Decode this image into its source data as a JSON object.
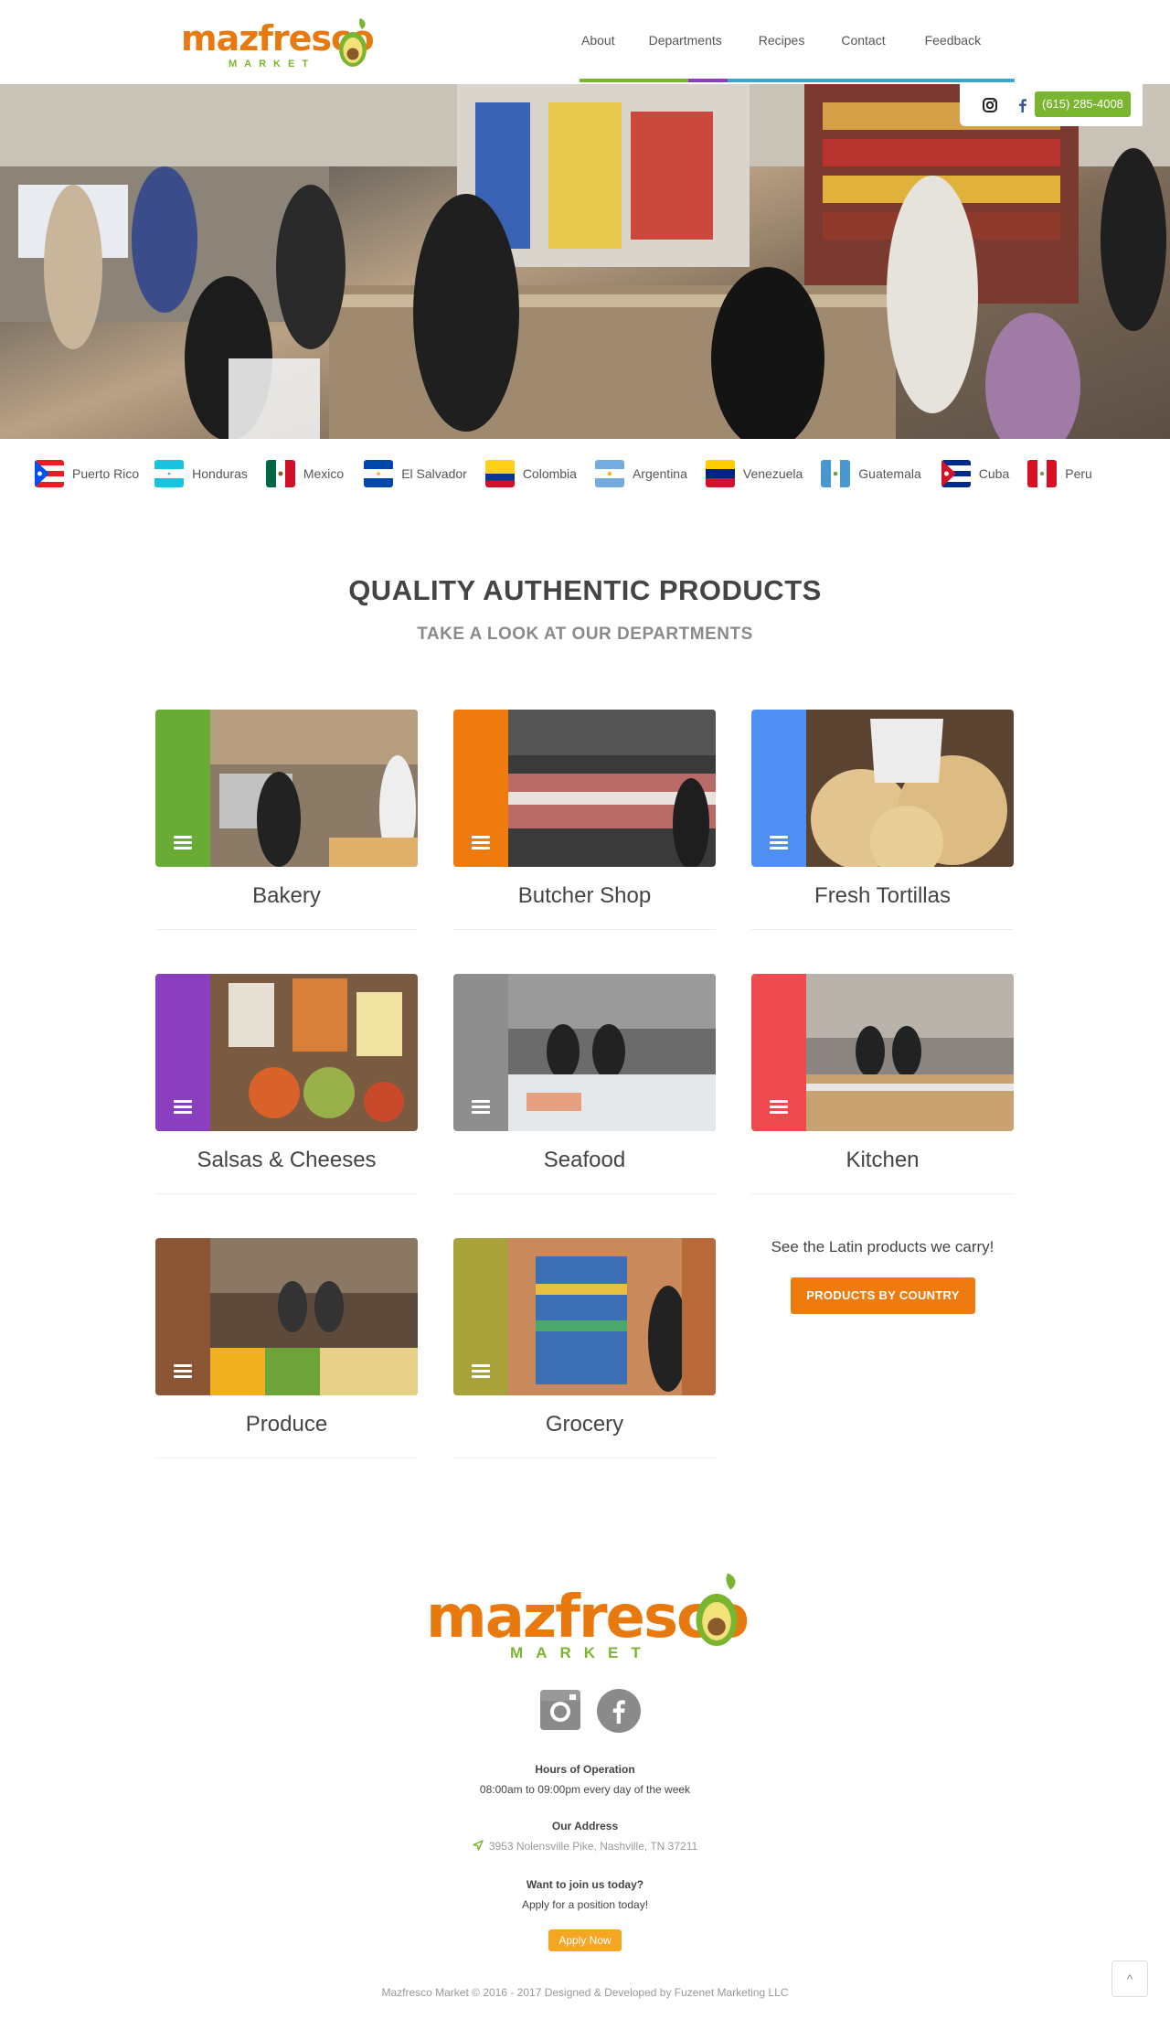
{
  "brand": {
    "logo_word": "mazfresco",
    "logo_sub": "MARKET",
    "colors": {
      "orange": "#e8790f",
      "green": "#7ab530"
    }
  },
  "nav": {
    "items": [
      "About",
      "Departments",
      "Recipes",
      "Contact",
      "Feedback"
    ]
  },
  "header_social": {
    "icons": [
      "instagram-icon",
      "facebook-icon"
    ],
    "phone": "(615) 285-4008"
  },
  "countries": [
    "Puerto Rico",
    "Honduras",
    "Mexico",
    "El Salvador",
    "Colombia",
    "Argentina",
    "Venezuela",
    "Guatemala",
    "Cuba",
    "Peru"
  ],
  "departments_section": {
    "title": "QUALITY AUTHENTIC PRODUCTS",
    "subtitle": "TAKE A LOOK AT OUR DEPARTMENTS"
  },
  "departments": [
    {
      "name": "Bakery",
      "color": "#6aab35"
    },
    {
      "name": "Butcher Shop",
      "color": "#ef7b0f"
    },
    {
      "name": "Fresh Tortillas",
      "color": "#4f8ef2"
    },
    {
      "name": "Salsas & Cheeses",
      "color": "#8a3fbf"
    },
    {
      "name": "Seafood",
      "color": "#8e8e8e"
    },
    {
      "name": "Kitchen",
      "color": "#ef4a4f"
    },
    {
      "name": "Produce",
      "color": "#8b5636"
    },
    {
      "name": "Grocery",
      "color": "#a9a23a"
    }
  ],
  "products_by_country": {
    "text": "See the Latin products we carry!",
    "button": "PRODUCTS BY COUNTRY"
  },
  "footer": {
    "hours_title": "Hours of Operation",
    "hours_text": "08:00am to 09:00pm every day of the week",
    "address_title": "Our Address",
    "address_text": "3953 Nolensville Pike, Nashville, TN 37211",
    "join_title": "Want to join us today?",
    "join_text": "Apply for a position today!",
    "apply_button": "Apply Now",
    "copyright": "Mazfresco Market © 2016 - 2017 Designed & Developed by Fuzenet Marketing LLC",
    "to_top": "^"
  }
}
